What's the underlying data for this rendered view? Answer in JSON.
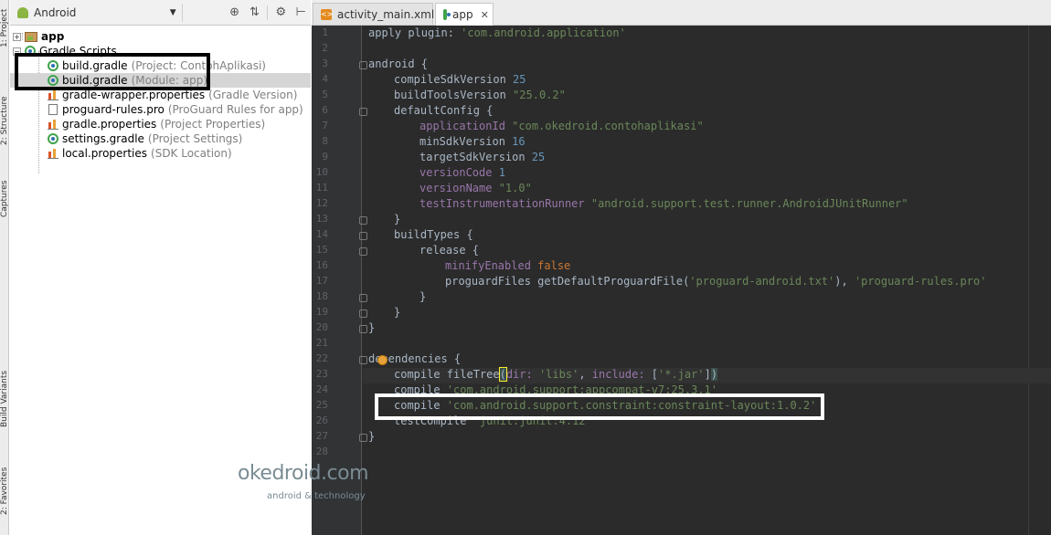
{
  "side_strip": {
    "labels": [
      "1: Project",
      "2: Structure",
      "Captures",
      "Build Variants",
      "2: Favorites"
    ]
  },
  "project_panel": {
    "view_mode": "Android",
    "toolbar_icons": [
      "target-icon",
      "collapse-icon",
      "gear-icon",
      "hide-icon"
    ],
    "tree": [
      {
        "name": "app",
        "desc": ""
      },
      {
        "name": "Gradle Scripts",
        "desc": ""
      },
      {
        "name": "build.gradle",
        "desc": "(Project: ContohAplikasi)"
      },
      {
        "name": "build.gradle",
        "desc": "(Module: app)"
      },
      {
        "name": "gradle-wrapper.properties",
        "desc": "(Gradle Version)"
      },
      {
        "name": "proguard-rules.pro",
        "desc": "(ProGuard Rules for app)"
      },
      {
        "name": "gradle.properties",
        "desc": "(Project Properties)"
      },
      {
        "name": "settings.gradle",
        "desc": "(Project Settings)"
      },
      {
        "name": "local.properties",
        "desc": "(SDK Location)"
      }
    ]
  },
  "editor": {
    "tabs": [
      {
        "label": "activity_main.xml",
        "active": false
      },
      {
        "label": "app",
        "active": true
      }
    ],
    "line_numbers": [
      "1",
      "2",
      "3",
      "4",
      "5",
      "6",
      "7",
      "8",
      "9",
      "10",
      "11",
      "12",
      "13",
      "14",
      "15",
      "16",
      "17",
      "18",
      "19",
      "20",
      "21",
      "22",
      "23",
      "24",
      "25",
      "26",
      "27",
      "28"
    ],
    "code": {
      "l1": {
        "a": "apply plugin: ",
        "b": "'com.android.application'"
      },
      "l3": {
        "a": "android {"
      },
      "l4": {
        "a": "compileSdkVersion ",
        "b": "25"
      },
      "l5": {
        "a": "buildToolsVersion ",
        "b": "\"25.0.2\""
      },
      "l6": {
        "a": "defaultConfig {"
      },
      "l7": {
        "a": "applicationId ",
        "b": "\"com.okedroid.contohaplikasi\""
      },
      "l8": {
        "a": "minSdkVersion ",
        "b": "16"
      },
      "l9": {
        "a": "targetSdkVersion ",
        "b": "25"
      },
      "l10": {
        "a": "versionCode ",
        "b": "1"
      },
      "l11": {
        "a": "versionName ",
        "b": "\"1.0\""
      },
      "l12": {
        "a": "testInstrumentationRunner ",
        "b": "\"android.support.test.runner.AndroidJUnitRunner\""
      },
      "l13": {
        "a": "}"
      },
      "l14": {
        "a": "buildTypes {"
      },
      "l15": {
        "a": "release {"
      },
      "l16": {
        "a": "minifyEnabled ",
        "b": "false"
      },
      "l17": {
        "a": "proguardFiles getDefaultProguardFile(",
        "b": "'proguard-android.txt'",
        "c": "), ",
        "d": "'proguard-rules.pro'"
      },
      "l18": {
        "a": "}"
      },
      "l19": {
        "a": "}"
      },
      "l20": {
        "a": "}"
      },
      "l22": {
        "a": "dependencies {"
      },
      "l23": {
        "a": "compile fileTree",
        "b": "(",
        "c": "dir: ",
        "d": "'libs'",
        "e": ", ",
        "f": "include: ",
        "g": "[",
        "h": "'*.jar'",
        "i": "]",
        "j": ")"
      },
      "l24": {
        "a": "compile ",
        "b": "'com.android.support:appcompat-v7:25.3.1'"
      },
      "l25": {
        "a": "compile ",
        "b": "'com.android.support.constraint:constraint-layout:1.0.2'"
      },
      "l26": {
        "a": "testCompile ",
        "b": "'junit:junit:4.12'"
      },
      "l27": {
        "a": "}"
      }
    }
  },
  "watermark": {
    "brand": "okedroid.com",
    "tagline": "android & technology"
  },
  "colors": {
    "editor_bg": "#2b2b2b",
    "keyword": "#cc7832",
    "string": "#6a8759",
    "number": "#6897bb",
    "property": "#9876aa",
    "annotation_box": "#000000"
  }
}
